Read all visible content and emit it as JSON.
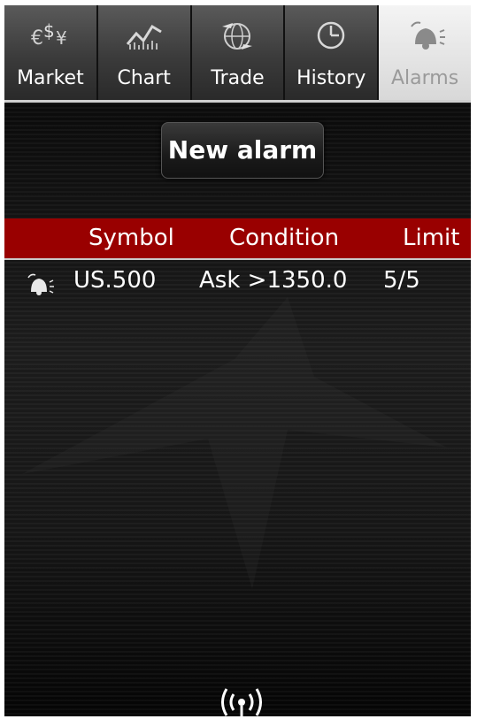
{
  "tabs": [
    {
      "label": "Market",
      "icon": "currency-icon",
      "active": false
    },
    {
      "label": "Chart",
      "icon": "chart-icon",
      "active": false
    },
    {
      "label": "Trade",
      "icon": "globe-icon",
      "active": false
    },
    {
      "label": "History",
      "icon": "clock-icon",
      "active": false
    },
    {
      "label": "Alarms",
      "icon": "alarm-bell-icon",
      "active": true
    }
  ],
  "actions": {
    "new_alarm_label": "New alarm"
  },
  "table": {
    "columns": [
      "Symbol",
      "Condition",
      "Limit"
    ],
    "rows": [
      {
        "icon": "alarm-bell-icon",
        "symbol": "US.500",
        "condition": "Ask >1350.0",
        "limit": "5/5"
      }
    ]
  },
  "status": {
    "icon": "connection-signal-icon"
  },
  "colors": {
    "header_bg": "#990000",
    "active_tab_bg": "#e8e8e8"
  }
}
